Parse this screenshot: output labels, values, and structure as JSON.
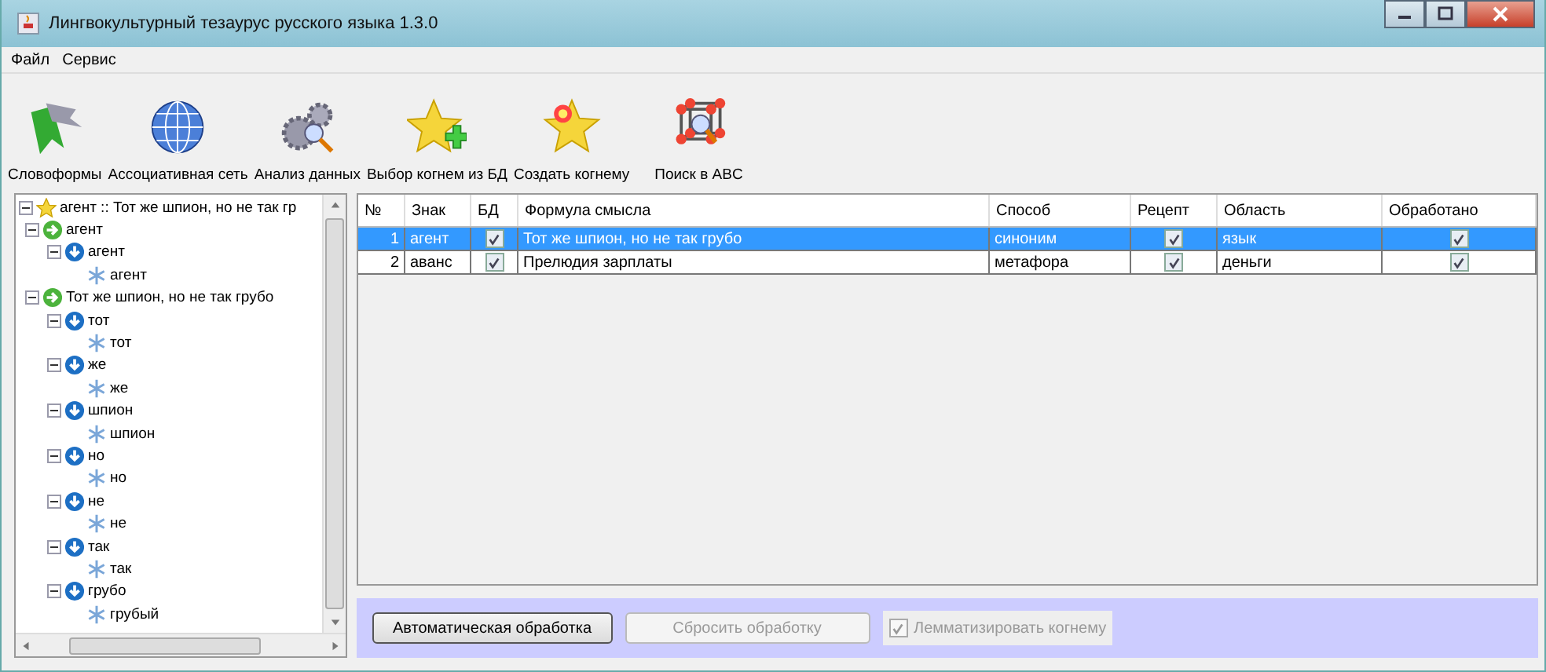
{
  "window": {
    "title": "Лингвокультурный тезаурус русского языка 1.3.0"
  },
  "menu": [
    "Файл",
    "Сервис"
  ],
  "toolbar": [
    {
      "label": "Словоформы",
      "kind": "ribbons"
    },
    {
      "label": "Ассоциативная сеть",
      "kind": "globe"
    },
    {
      "label": "Анализ данных",
      "kind": "gears"
    },
    {
      "label": "Выбор когнем из БД",
      "kind": "star-plus"
    },
    {
      "label": "Создать когнему",
      "kind": "star-burst"
    },
    {
      "label": "Поиск в ABC",
      "kind": "cube"
    }
  ],
  "tree": {
    "label": "агент :: Тот же шпион, но не так гр",
    "kind": "root",
    "expanded": true,
    "children": [
      {
        "label": "агент",
        "kind": "phrase",
        "expanded": true,
        "children": [
          {
            "label": "агент",
            "kind": "word",
            "expanded": true,
            "children": [
              {
                "label": "агент",
                "kind": "lemma"
              }
            ]
          }
        ]
      },
      {
        "label": "Тот же шпион, но не так грубо",
        "kind": "phrase",
        "expanded": true,
        "children": [
          {
            "label": "тот",
            "kind": "word",
            "expanded": true,
            "children": [
              {
                "label": "тот",
                "kind": "lemma"
              }
            ]
          },
          {
            "label": "же",
            "kind": "word",
            "expanded": true,
            "children": [
              {
                "label": "же",
                "kind": "lemma"
              }
            ]
          },
          {
            "label": "шпион",
            "kind": "word",
            "expanded": true,
            "children": [
              {
                "label": "шпион",
                "kind": "lemma"
              }
            ]
          },
          {
            "label": "но",
            "kind": "word",
            "expanded": true,
            "children": [
              {
                "label": "но",
                "kind": "lemma"
              }
            ]
          },
          {
            "label": "не",
            "kind": "word",
            "expanded": true,
            "children": [
              {
                "label": "не",
                "kind": "lemma"
              }
            ]
          },
          {
            "label": "так",
            "kind": "word",
            "expanded": true,
            "children": [
              {
                "label": "так",
                "kind": "lemma"
              }
            ]
          },
          {
            "label": "грубо",
            "kind": "word",
            "expanded": true,
            "children": [
              {
                "label": "грубый",
                "kind": "lemma"
              }
            ]
          }
        ]
      }
    ]
  },
  "table": {
    "columns": [
      "№",
      "Знак",
      "БД",
      "Формула смысла",
      "Способ",
      "Рецепт",
      "Область",
      "Обработано"
    ],
    "rows": [
      {
        "num": "1",
        "sign": "агент",
        "db": true,
        "formula": "Тот же шпион, но не так грубо",
        "method": "синоним",
        "recipe": true,
        "area": "язык",
        "processed": true,
        "selected": true
      },
      {
        "num": "2",
        "sign": "аванс",
        "db": true,
        "formula": "Прелюдия зарплаты",
        "method": "метафора",
        "recipe": true,
        "area": "деньги",
        "processed": true,
        "selected": false
      }
    ]
  },
  "actions": {
    "auto": {
      "label": "Автоматическая обработка",
      "disabled": false
    },
    "reset": {
      "label": "Сбросить обработку",
      "disabled": true
    },
    "lemmatize": {
      "label": "Лемматизировать когнему",
      "checked": true,
      "disabled": true
    }
  }
}
